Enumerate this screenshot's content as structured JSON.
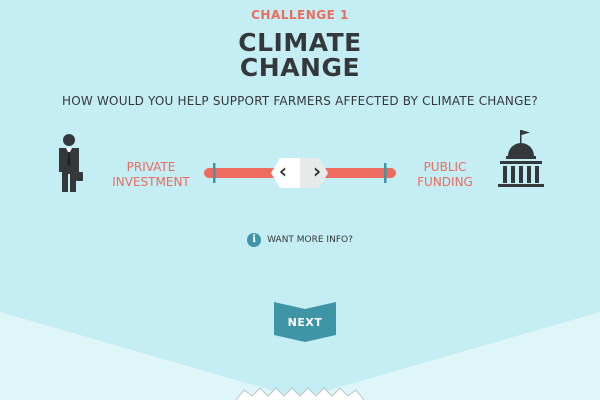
{
  "challenge": {
    "label": "CHALLENGE 1",
    "title_line1": "CLIMATE",
    "title_line2": "CHANGE",
    "question": "HOW WOULD YOU HELP SUPPORT FARMERS AFFECTED BY CLIMATE CHANGE?"
  },
  "choices": {
    "left_line1": "PRIVATE",
    "left_line2": "INVESTMENT",
    "left_icon": "businessman-icon",
    "right_line1": "PUBLIC",
    "right_line2": "FUNDING",
    "right_icon": "government-building-icon"
  },
  "slider": {
    "left_arrow": "‹",
    "right_arrow": "›",
    "value": 0.5
  },
  "info": {
    "icon": "i",
    "text": "WANT MORE INFO?"
  },
  "next": {
    "label": "NEXT"
  },
  "colors": {
    "background": "#c4eef3",
    "accent": "#ee6b5f",
    "text": "#35383a",
    "button": "#3e95a6"
  }
}
